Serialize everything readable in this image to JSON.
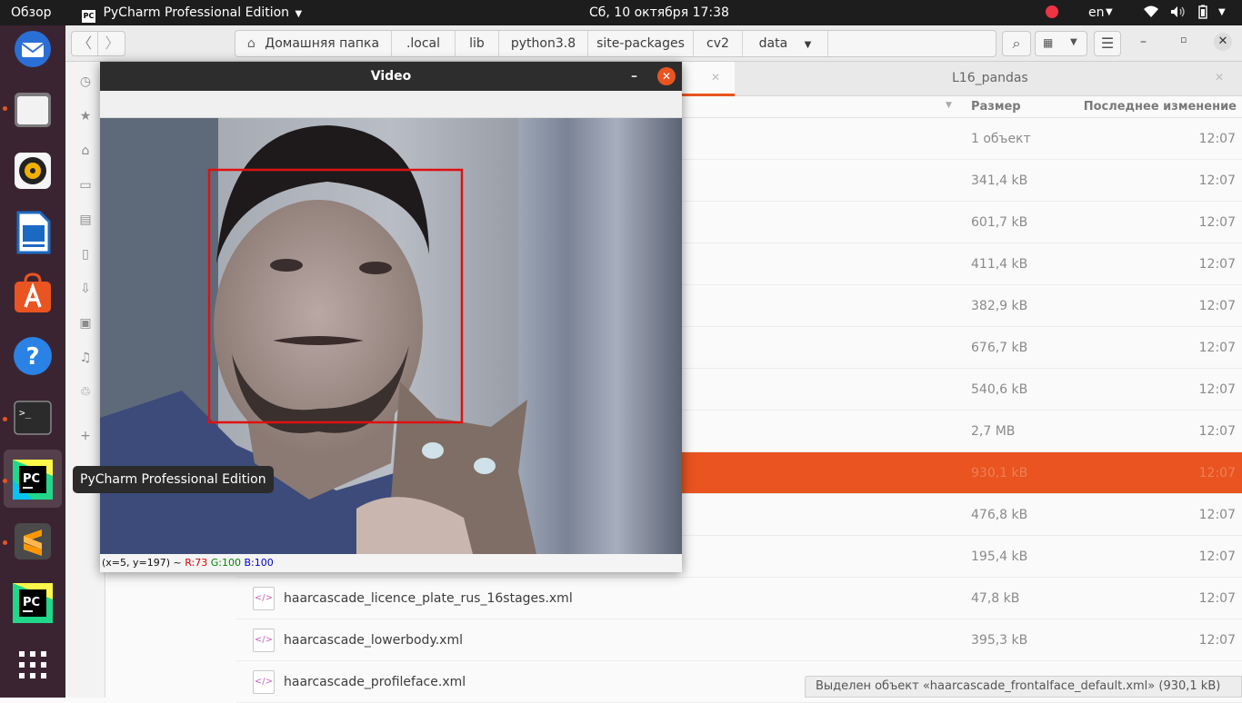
{
  "topbar": {
    "overview": "Обзор",
    "app_menu": "PyCharm Professional Edition",
    "clock": "Сб, 10 октября  17:38",
    "keyboard_layout": "en"
  },
  "dock": {
    "tooltip": "PyCharm Professional Edition"
  },
  "files": {
    "pathbar": [
      "Домашняя папка",
      ".local",
      "lib",
      "python3.8",
      "site-packages",
      "cv2",
      "data"
    ],
    "tab_second": "L16_pandas",
    "columns": {
      "size": "Размер",
      "modified": "Последнее изменение"
    },
    "rows": [
      {
        "name": "",
        "size": "1 объект",
        "time": "12:07"
      },
      {
        "name": "",
        "size": "341,4 kB",
        "time": "12:07"
      },
      {
        "name": "",
        "size": "601,7 kB",
        "time": "12:07"
      },
      {
        "name": "",
        "size": "411,4 kB",
        "time": "12:07"
      },
      {
        "name": "",
        "size": "382,9 kB",
        "time": "12:07"
      },
      {
        "name": "",
        "size": "676,7 kB",
        "time": "12:07"
      },
      {
        "name": "",
        "size": "540,6 kB",
        "time": "12:07"
      },
      {
        "name": "",
        "size": "2,7 MB",
        "time": "12:07"
      },
      {
        "name": "",
        "size": "930,1 kB",
        "time": "12:07"
      },
      {
        "name": "",
        "size": "476,8 kB",
        "time": "12:07"
      },
      {
        "name": "",
        "size": "195,4 kB",
        "time": "12:07"
      },
      {
        "name": "haarcascade_licence_plate_rus_16stages.xml",
        "size": "47,8 kB",
        "time": "12:07"
      },
      {
        "name": "haarcascade_lowerbody.xml",
        "size": "395,3 kB",
        "time": "12:07"
      },
      {
        "name": "haarcascade_profileface.xml",
        "size": "",
        "time": ""
      }
    ],
    "file_icon": "</>",
    "status": "Выделен объект «haarcascade_frontalface_default.xml» (930,1 kB)"
  },
  "video": {
    "title": "Video",
    "status_coords": "(x=5, y=197) ~",
    "status_r": "R:73",
    "status_g": "G:100",
    "status_b": "B:100"
  }
}
